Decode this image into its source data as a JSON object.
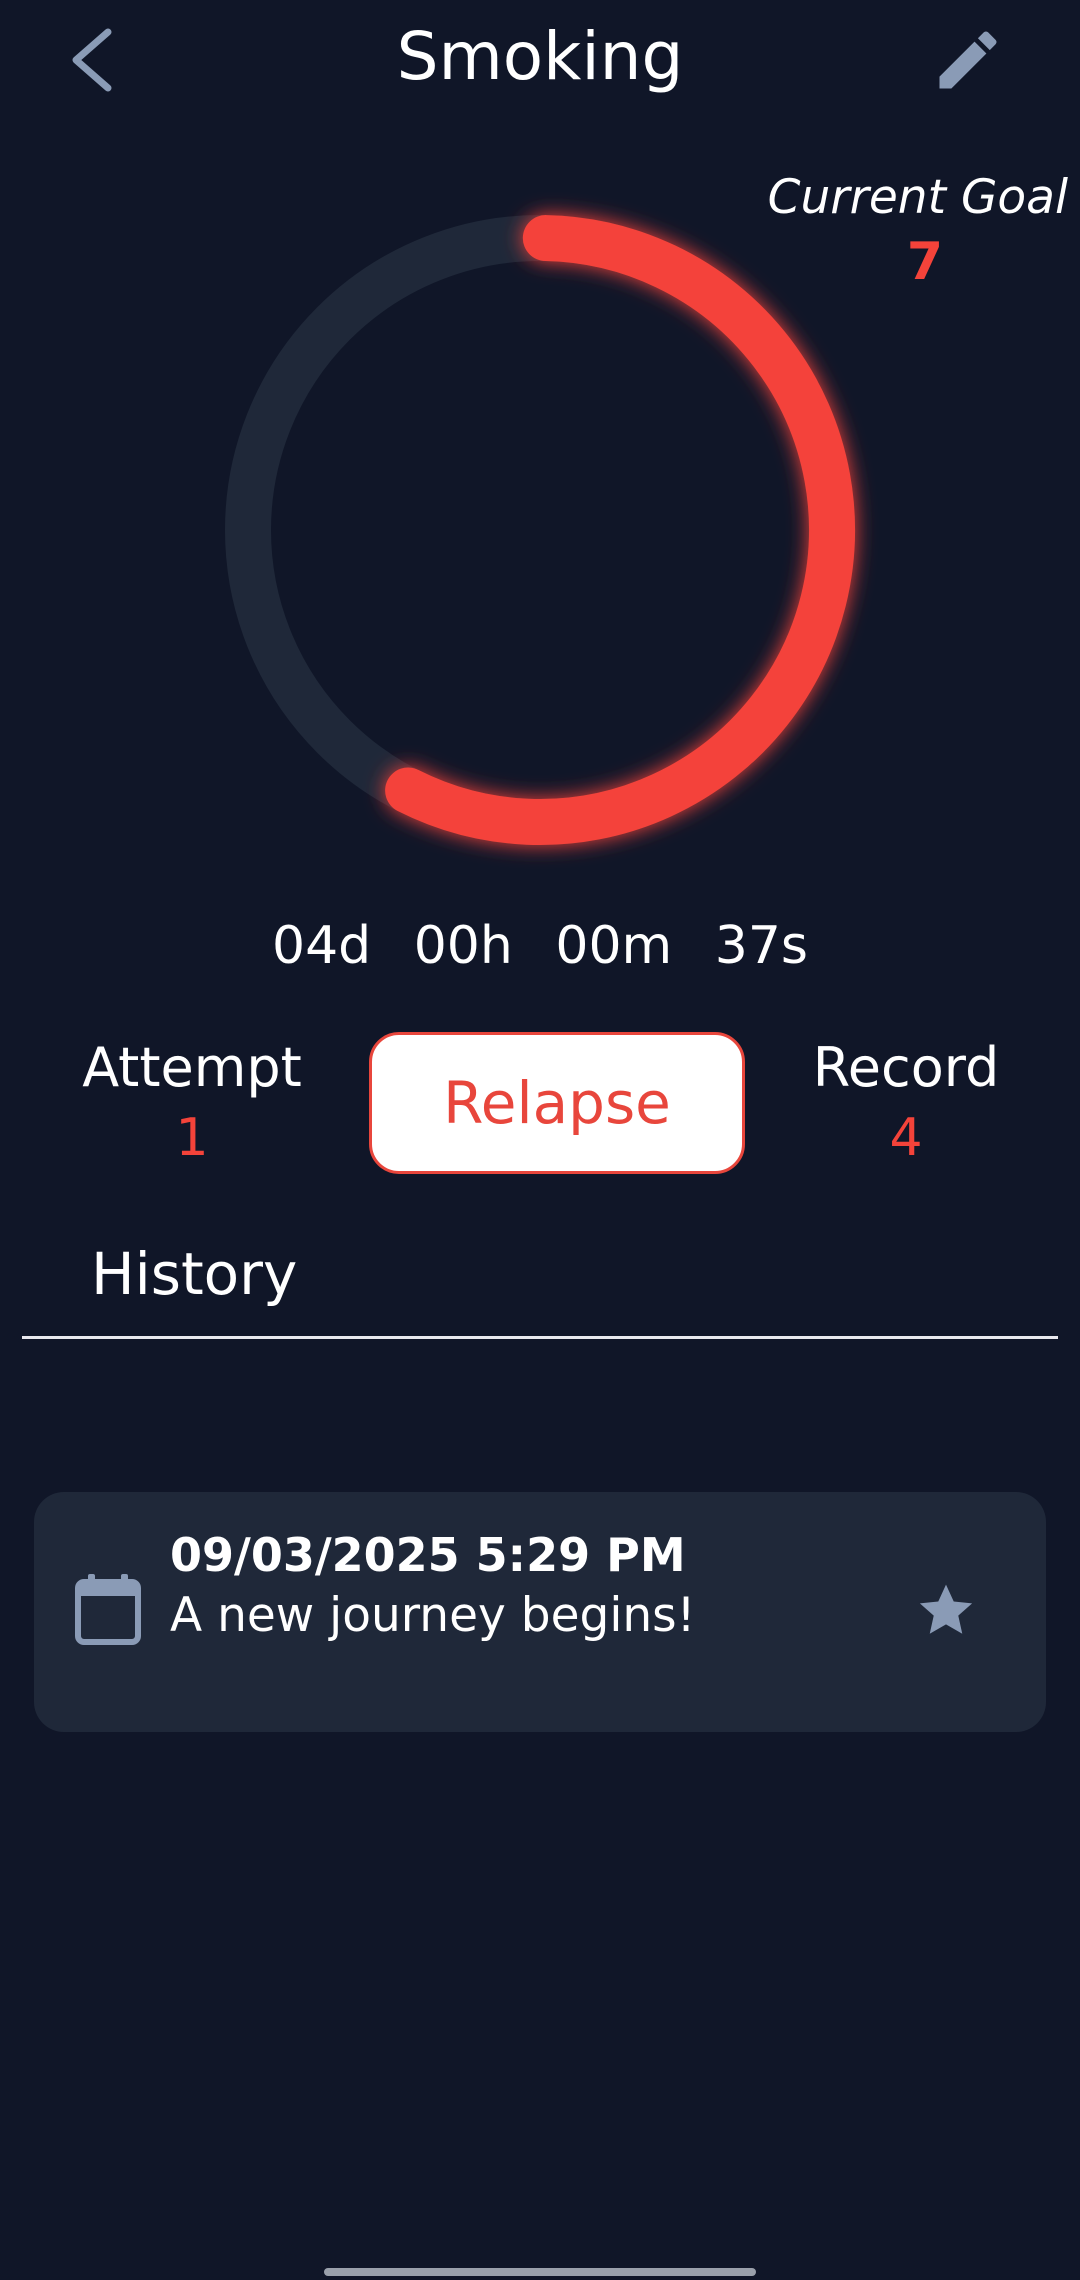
{
  "header": {
    "title": "Smoking",
    "back_icon": "chevron-left-icon",
    "edit_icon": "pencil-icon"
  },
  "goal": {
    "label": "Current Goal",
    "value": "7"
  },
  "progress": {
    "fraction": 0.5714,
    "color": "#f4433a",
    "track_color": "#1f2839"
  },
  "timer": {
    "days": "04d",
    "hours": "00h",
    "minutes": "00m",
    "seconds": "37s"
  },
  "stats": {
    "attempt_label": "Attempt",
    "attempt_value": "1",
    "record_label": "Record",
    "record_value": "4"
  },
  "actions": {
    "relapse_label": "Relapse"
  },
  "history": {
    "title": "History",
    "entries": [
      {
        "date": "09/03/2025 5:29 PM",
        "text": "A new journey begins!",
        "icon": "calendar-icon",
        "badge_icon": "star-icon"
      }
    ]
  },
  "colors": {
    "background": "#101628",
    "accent": "#f4433a",
    "card": "#1f2839",
    "icon": "#8a9bb6"
  }
}
